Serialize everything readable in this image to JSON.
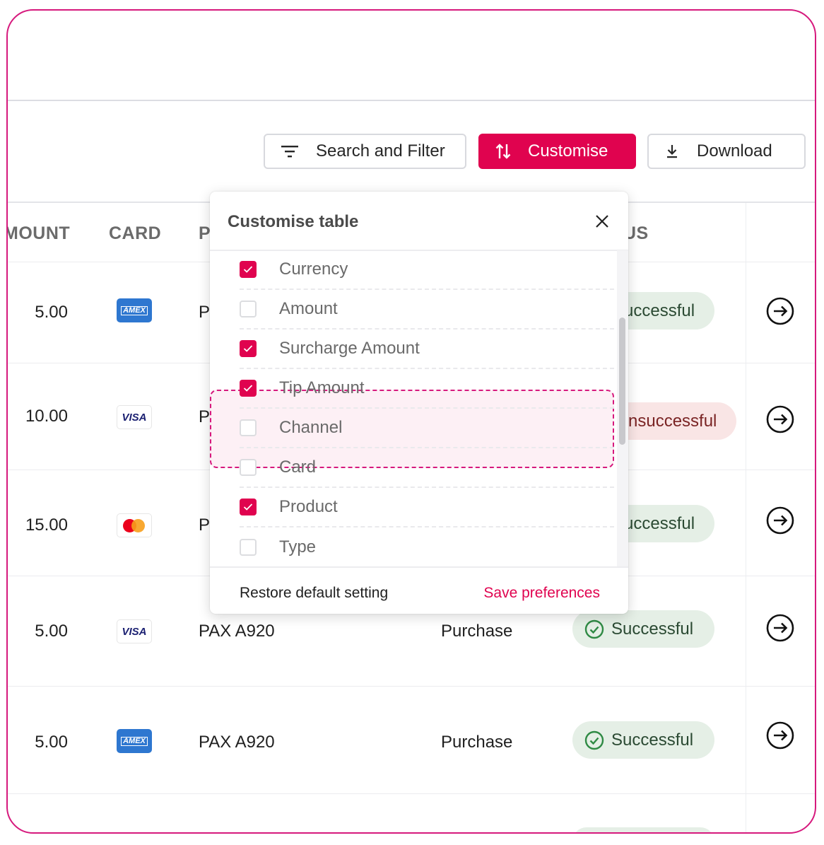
{
  "toolbar": {
    "search_filter_label": "Search and Filter",
    "customise_label": "Customise",
    "download_label": "Download"
  },
  "table": {
    "headers": {
      "amount": "MOUNT",
      "card": "CARD",
      "product": "P",
      "status": "US"
    },
    "rows": [
      {
        "amount": "5.00",
        "card": "amex",
        "card_text": "AMEX",
        "product": "P",
        "type": "",
        "status": "uccessful",
        "status_kind": "success"
      },
      {
        "amount": "10.00",
        "card": "visa",
        "card_text": "VISA",
        "product": "P",
        "type": "",
        "status": "nsuccessful",
        "status_kind": "failure"
      },
      {
        "amount": "15.00",
        "card": "mastercard",
        "card_text": "",
        "product": "P",
        "type": "",
        "status": "uccessful",
        "status_kind": "success"
      },
      {
        "amount": "5.00",
        "card": "visa",
        "card_text": "VISA",
        "product": "PAX A920",
        "type": "Purchase",
        "status": "Successful",
        "status_kind": "success"
      },
      {
        "amount": "5.00",
        "card": "amex",
        "card_text": "AMEX",
        "product": "PAX A920",
        "type": "Purchase",
        "status": "Successful",
        "status_kind": "success"
      }
    ]
  },
  "customise_popup": {
    "title": "Customise table",
    "options": [
      {
        "label": "Currency",
        "checked": true
      },
      {
        "label": "Amount",
        "checked": false
      },
      {
        "label": "Surcharge Amount",
        "checked": true
      },
      {
        "label": "Tip Amount",
        "checked": true
      },
      {
        "label": "Channel",
        "checked": false
      },
      {
        "label": "Card",
        "checked": false
      },
      {
        "label": "Product",
        "checked": true
      },
      {
        "label": "Type",
        "checked": false
      }
    ],
    "restore_label": "Restore default setting",
    "save_label": "Save preferences"
  },
  "colors": {
    "accent": "#e0034f",
    "frame": "#d6197d",
    "success_bg": "#e5efe6",
    "failure_bg": "#f9e5e5"
  }
}
